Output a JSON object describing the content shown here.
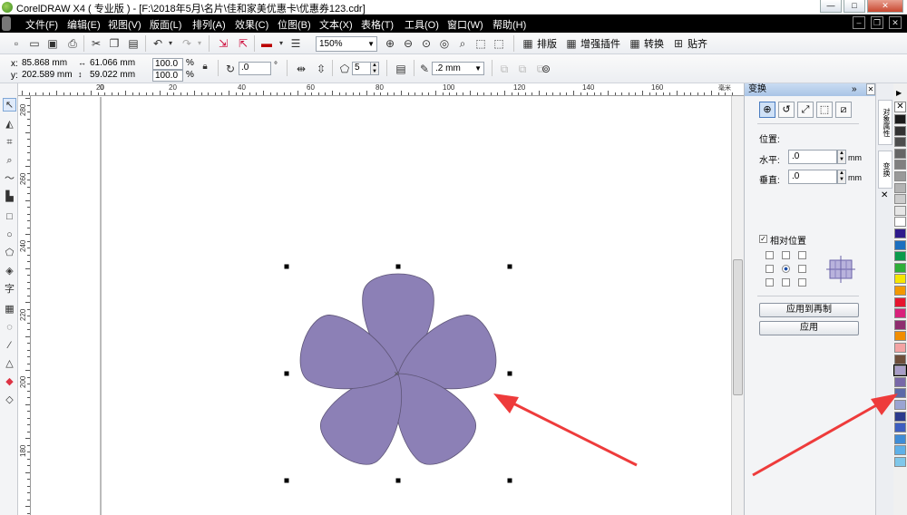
{
  "window": {
    "title": "CorelDRAW X4 ( 专业版 ) - [F:\\2018年5月\\名片\\佳和家美优惠卡\\优惠券123.cdr]",
    "min": "—",
    "max": "□",
    "close": "✕"
  },
  "menu": [
    "文件(F)",
    "编辑(E)",
    "视图(V)",
    "版面(L)",
    "排列(A)",
    "效果(C)",
    "位图(B)",
    "文本(X)",
    "表格(T)",
    "工具(O)",
    "窗口(W)",
    "帮助(H)"
  ],
  "toolbar": {
    "zoom": "150%",
    "plugins": [
      {
        "label": "排版"
      },
      {
        "label": "增强插件"
      },
      {
        "label": "转换"
      },
      {
        "label": "贴齐"
      }
    ]
  },
  "property_bar": {
    "x_label": "x:",
    "x_value": "85.868 mm",
    "y_label": "y:",
    "y_value": "202.589 mm",
    "w_value": "61.066 mm",
    "h_value": "59.022 mm",
    "scale_w": "100.0",
    "scale_h": "100.0",
    "percent": "%",
    "rotation": ".0",
    "degree": "°",
    "points": "5",
    "outline": ".2 mm"
  },
  "ruler": {
    "top_labels": [
      "20",
      "0",
      "20",
      "40",
      "60",
      "80",
      "100",
      "120",
      "140",
      "160",
      "毫米"
    ],
    "left_labels": [
      "280",
      "260",
      "240",
      "220",
      "200",
      "180"
    ]
  },
  "docker": {
    "title": "变换",
    "collapse": "»",
    "section_position": "位置:",
    "h_label": "水平:",
    "h_value": ".0",
    "h_unit": "mm",
    "v_label": "垂直:",
    "v_value": ".0",
    "v_unit": "mm",
    "relative_label": "相对位置",
    "apply_dup": "应用到再制",
    "apply": "应用"
  },
  "side_tabs": {
    "tab1": "对象属性",
    "tab2": "变换"
  },
  "colors": {
    "flower_fill": "#8c80b6",
    "flower_outline": "#5e5577",
    "arrow": "#ee3b3b",
    "palette": [
      "#ffffff",
      "#1b1b1b",
      "#333333",
      "#4d4d4d",
      "#666666",
      "#808080",
      "#999999",
      "#b3b3b3",
      "#cccccc",
      "#e6e6e6",
      "#ffffff",
      "#2e1a8c",
      "#1c6fc0",
      "#0a9a4c",
      "#2fae38",
      "#f6e600",
      "#f39800",
      "#e6162f",
      "#d9217b",
      "#8e2d6f",
      "#f18d00",
      "#f3a3a3",
      "#6e4e3a",
      "#a89dc8",
      "#7868a8",
      "#5c6aa8",
      "#9aa4d2",
      "#2b3a8c",
      "#3d5ec0",
      "#3f8cd6",
      "#5fb0e8",
      "#7fc7ea"
    ]
  },
  "icons": {
    "select": "pointer-icon",
    "shape": "shape-icon",
    "zoom": "zoom-icon",
    "text": "text-icon"
  }
}
